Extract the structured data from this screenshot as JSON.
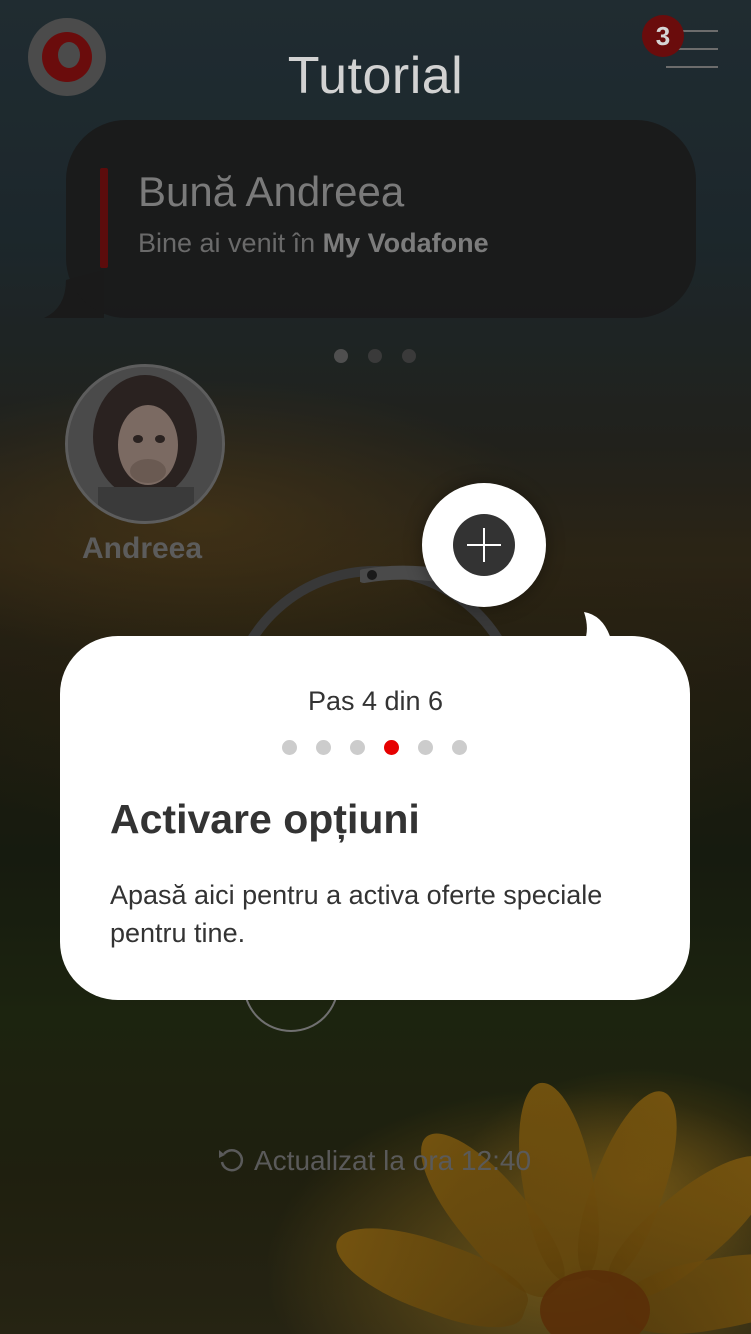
{
  "header": {
    "title": "Tutorial",
    "notification_count": "3",
    "logo_icon": "vodafone-logo-icon",
    "menu_icon": "hamburger-menu-icon"
  },
  "greeting": {
    "title": "Bună Andreea",
    "subtitle_prefix": "Bine ai venit în ",
    "subtitle_brand": "My Vodafone",
    "pager": {
      "total": 3,
      "active": 0
    }
  },
  "profile": {
    "name": "Andreea",
    "avatar_icon": "user-avatar"
  },
  "dashboard": {
    "updated_label": "Actualizat la ora 12:40",
    "refresh_icon": "refresh-icon"
  },
  "highlight": {
    "icon": "plus-icon"
  },
  "tutorial": {
    "step_label": "Pas 4 din 6",
    "step_current": 4,
    "step_total": 6,
    "title": "Activare opțiuni",
    "description": "Apasă aici pentru a activa oferte speciale pentru tine."
  },
  "colors": {
    "brand_red": "#e60000",
    "dot_inactive": "#cccccc",
    "text_dark": "#333333",
    "card_bg": "#ffffff"
  }
}
